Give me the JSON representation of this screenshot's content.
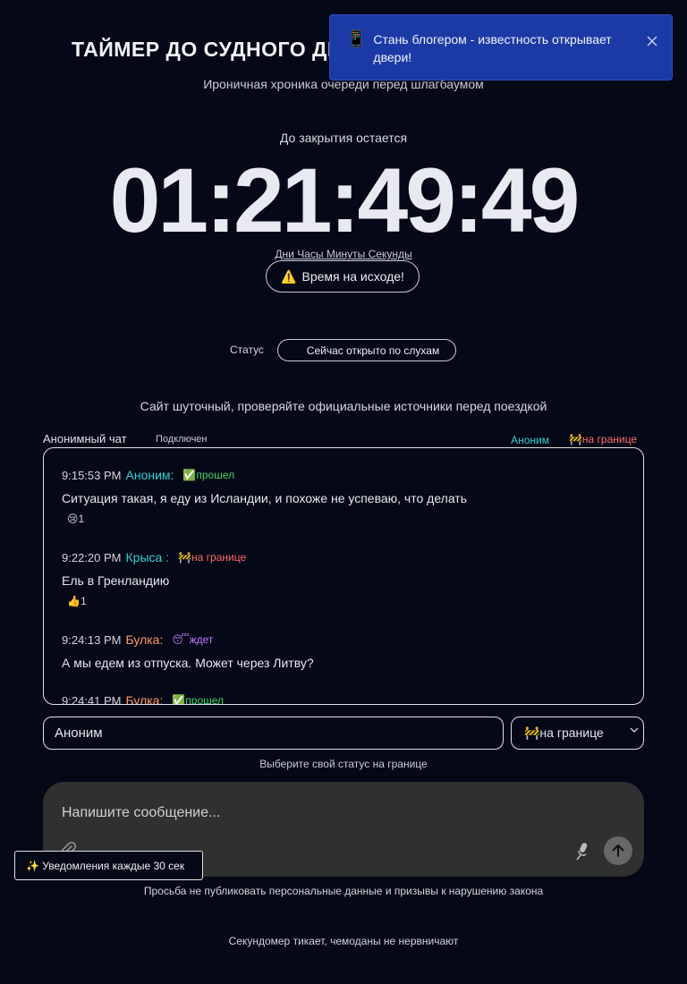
{
  "header": {
    "title": "ТАЙМЕР ДО СУДНОГО ДНЯ",
    "subtitle": "Ироничная хроника очереди перед шлагбаумом"
  },
  "countdown": {
    "label": "До закрытия остается",
    "value": "01:21:49:49",
    "units": "Дни Часы Минуты Секунды",
    "warning_icon": "⚠️",
    "warning_text": "Время на исходе!"
  },
  "status": {
    "label": "Статус",
    "value": "Сейчас открыто по слухам"
  },
  "disclaimer": "Сайт шуточный, проверяйте официальные источники перед поездкой",
  "chat": {
    "title": "Анонимный чат",
    "connection": "Подключен",
    "current_user": "Аноним",
    "current_status": "🚧на границе",
    "messages": [
      {
        "time": "9:15:53 PM",
        "author": "Аноним:",
        "author_color": "#2fd1d1",
        "badge": "✅прошел",
        "badge_color": "#3ed36a",
        "text": "Ситуация такая, я еду из Исландии, и похоже не успеваю, что делать",
        "reaction": "😢1"
      },
      {
        "time": "9:22:20 PM",
        "author": "Крыса :",
        "author_color": "#2fd1d1",
        "badge": "🚧на границе",
        "badge_color": "#ff6b6b",
        "text": "Ель в Гренландию",
        "reaction": "👍1"
      },
      {
        "time": "9:24:13 PM",
        "author": "Булка:",
        "author_color": "#ff9966",
        "badge": "😴ждет",
        "badge_color": "#c07dff",
        "text": "А мы едем из отпуска. Может через Литву?",
        "reaction": ""
      },
      {
        "time": "9:24:41 PM",
        "author": "Булка:",
        "author_color": "#ff9966",
        "badge": "✅прошел",
        "badge_color": "#3ed36a",
        "text": "",
        "reaction": ""
      }
    ]
  },
  "form": {
    "name_value": "Аноним",
    "status_selected": "🚧на границе",
    "status_hint": "Выберите свой статус на границе",
    "message_placeholder": "Напишите сообщение..."
  },
  "icons": {
    "attach": "paperclip-icon",
    "mic": "microphone-icon",
    "send": "arrow-up-icon",
    "close": "close-icon",
    "phone": "phone-icon"
  },
  "notifications_button": "✨ Уведомления каждые 30 сек",
  "rules": "Просьба не публиковать персональные данные и призывы к нарушению закона",
  "footer": "Секундомер тикает, чемоданы не нервничают",
  "toast": {
    "icon": "📱",
    "text": "Стань блогером - известность открывает двери!"
  },
  "colors": {
    "background": "#050816",
    "accent_cyan": "#2fd1d1",
    "accent_red": "#ff6b6b",
    "toast_bg": "#1c3aa6",
    "composer_bg": "#303030"
  }
}
